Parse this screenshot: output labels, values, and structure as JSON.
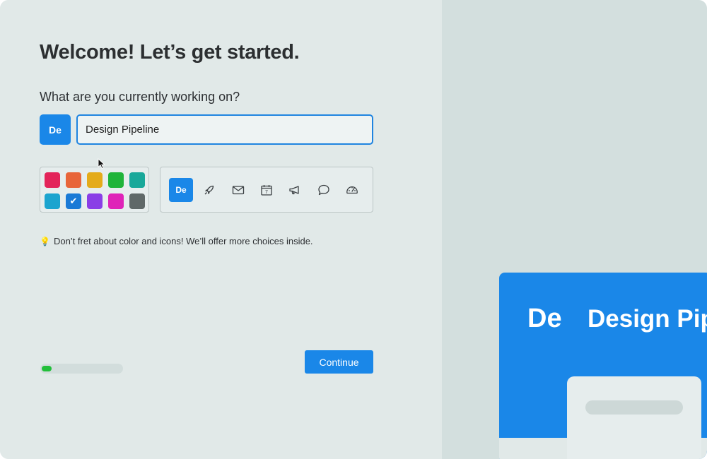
{
  "onboarding": {
    "title": "Welcome! Let’s get started.",
    "question": "What are you currently working on?",
    "project_abbr": "De",
    "project_name": "Design Pipeline",
    "hint_icon": "lightbulb-icon",
    "hint": "Don’t fret about color and icons! We’ll offer more choices inside.",
    "continue_label": "Continue",
    "progress": 0.12
  },
  "colors": [
    {
      "name": "crimson",
      "hex": "#e3245a",
      "selected": false
    },
    {
      "name": "orange",
      "hex": "#e8653a",
      "selected": false
    },
    {
      "name": "amber",
      "hex": "#e4ab1a",
      "selected": false
    },
    {
      "name": "green",
      "hex": "#1fb43a",
      "selected": false
    },
    {
      "name": "teal",
      "hex": "#19a89a",
      "selected": false
    },
    {
      "name": "cyan",
      "hex": "#1ba4cf",
      "selected": false
    },
    {
      "name": "blue",
      "hex": "#1a7ad6",
      "selected": true
    },
    {
      "name": "purple",
      "hex": "#8a3ee6",
      "selected": false
    },
    {
      "name": "magenta",
      "hex": "#df24b8",
      "selected": false
    },
    {
      "name": "gray",
      "hex": "#5f6868",
      "selected": false
    }
  ],
  "icons": [
    {
      "name": "abbreviation",
      "label": "De",
      "selected": true
    },
    {
      "name": "rocket-icon",
      "selected": false
    },
    {
      "name": "envelope-icon",
      "selected": false
    },
    {
      "name": "calendar-icon",
      "selected": false
    },
    {
      "name": "megaphone-icon",
      "selected": false
    },
    {
      "name": "speech-bubble-icon",
      "selected": false
    },
    {
      "name": "speedometer-icon",
      "selected": false
    }
  ],
  "preview": {
    "abbr": "De",
    "name": "Design Pipeline"
  },
  "theme": {
    "accent": "#1a87e8",
    "background_left": "#e1e9e8",
    "background_right": "#d3dfde",
    "progress_color": "#22bf3a"
  }
}
